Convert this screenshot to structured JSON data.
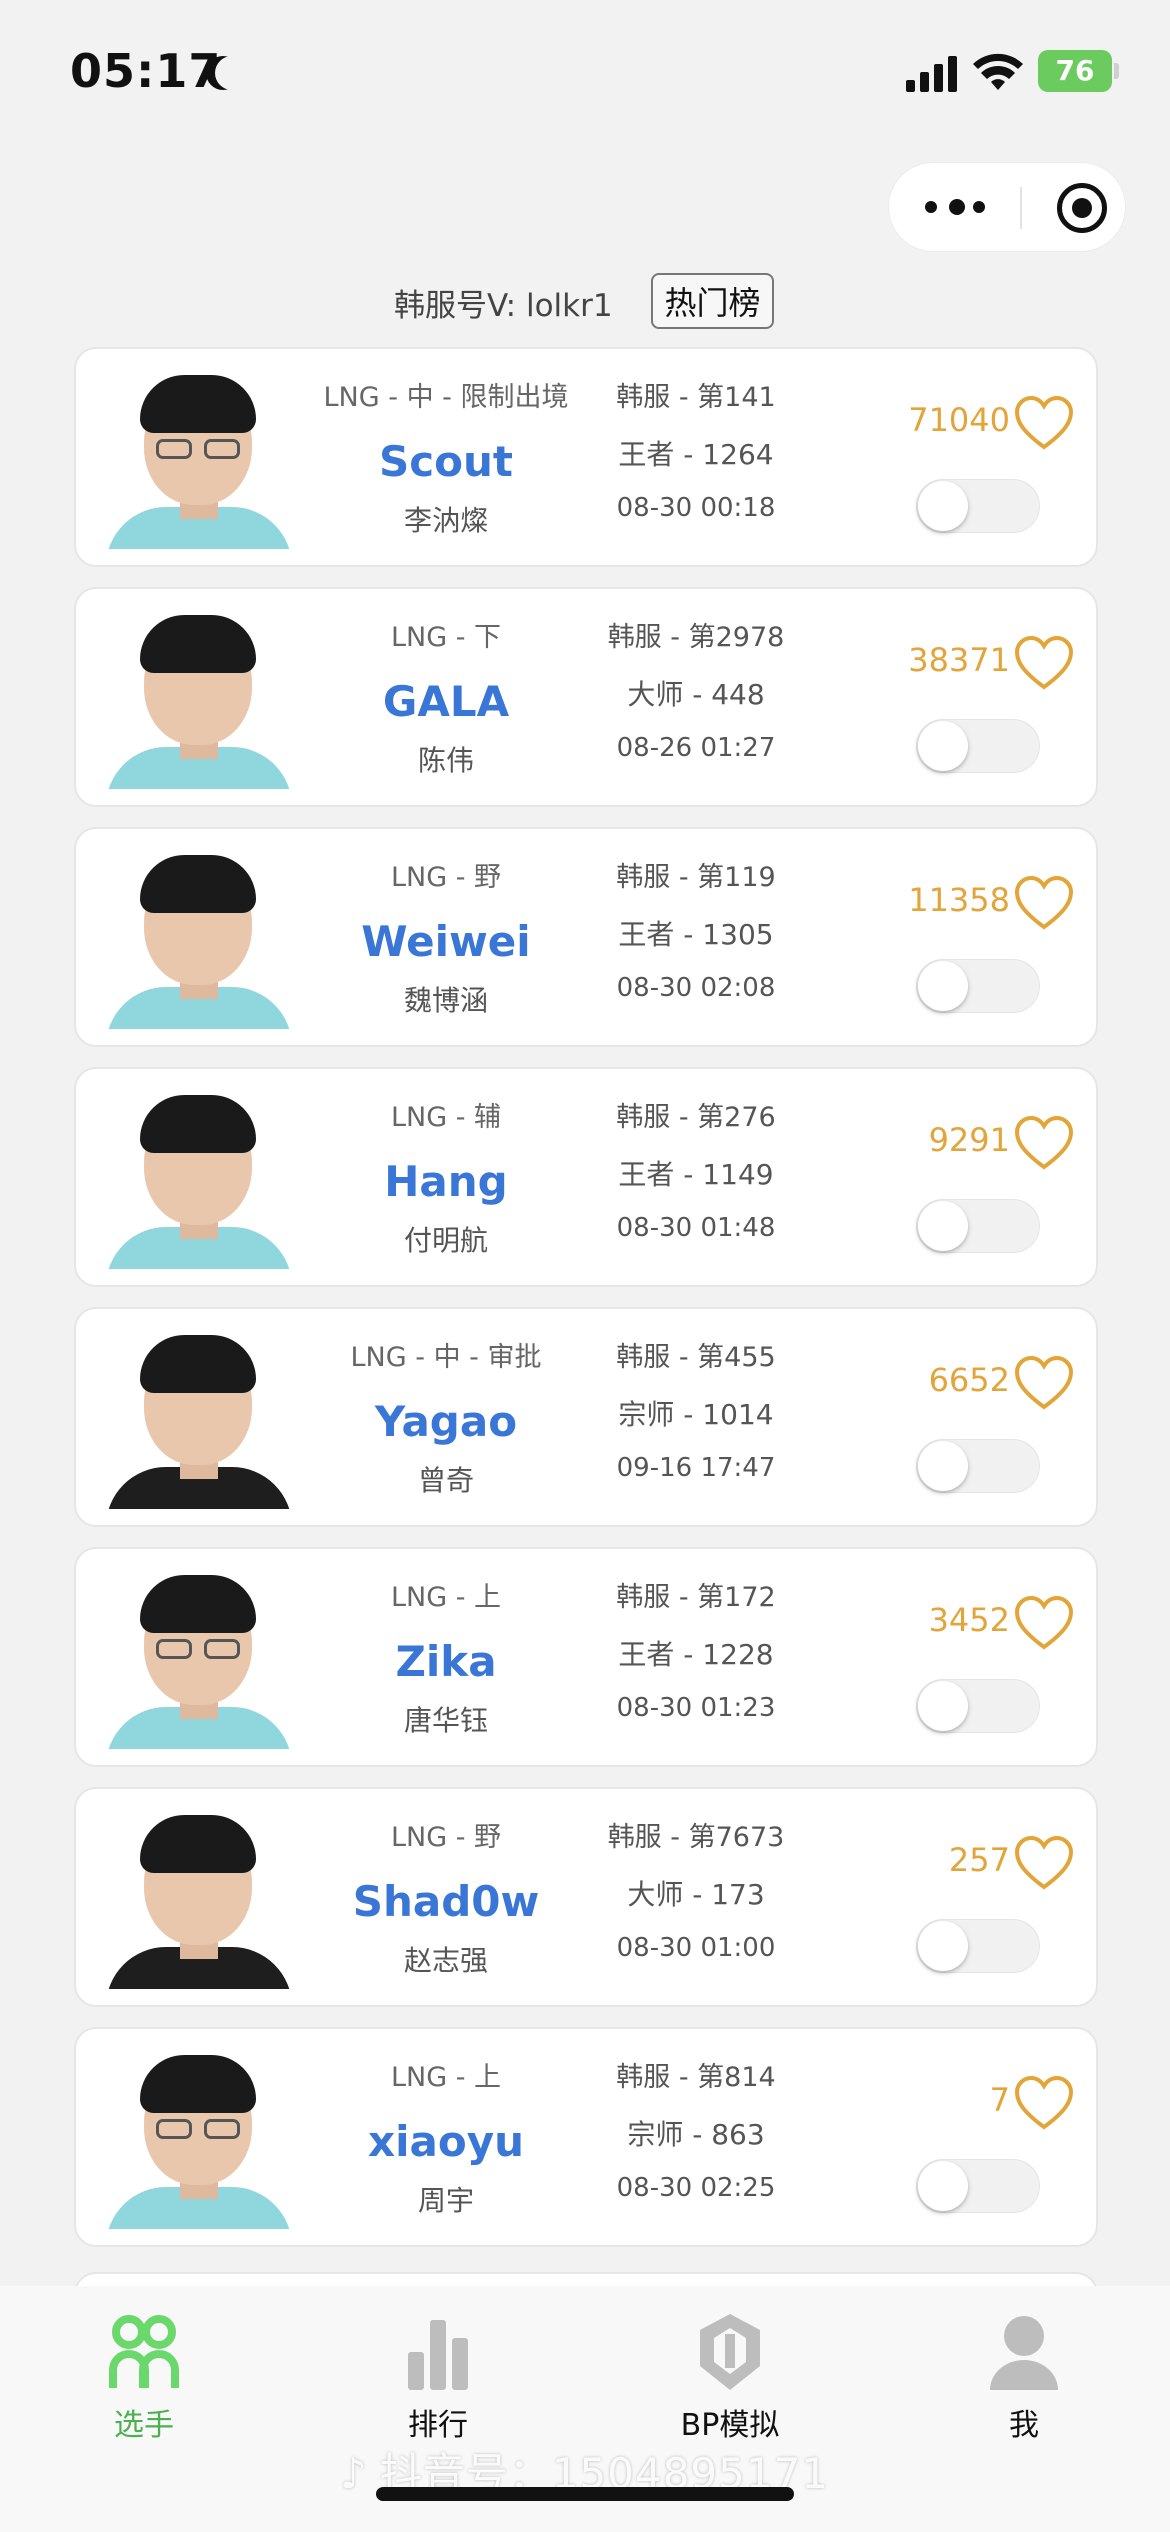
{
  "status_bar": {
    "time": "05:17",
    "battery": "76"
  },
  "header": {
    "account_label": "韩服号V: lolkr1",
    "hot_button": "热门榜"
  },
  "players": [
    {
      "team": "LNG - 中 - 限制出境",
      "name": "Scout",
      "real_name": "李汭燦",
      "server": "韩服 - 第141",
      "tier": "王者 - 1264",
      "date": "08-30 00:18",
      "likes": "71040",
      "glasses": true,
      "jersey": "light"
    },
    {
      "team": "LNG - 下",
      "name": "GALA",
      "real_name": "陈伟",
      "server": "韩服 - 第2978",
      "tier": "大师 - 448",
      "date": "08-26 01:27",
      "likes": "38371",
      "glasses": false,
      "jersey": "light"
    },
    {
      "team": "LNG - 野",
      "name": "Weiwei",
      "real_name": "魏博涵",
      "server": "韩服 - 第119",
      "tier": "王者 - 1305",
      "date": "08-30 02:08",
      "likes": "11358",
      "glasses": false,
      "jersey": "light"
    },
    {
      "team": "LNG - 辅",
      "name": "Hang",
      "real_name": "付明航",
      "server": "韩服 - 第276",
      "tier": "王者 - 1149",
      "date": "08-30 01:48",
      "likes": "9291",
      "glasses": false,
      "jersey": "light"
    },
    {
      "team": "LNG - 中 - 审批",
      "name": "Yagao",
      "real_name": "曾奇",
      "server": "韩服 - 第455",
      "tier": "宗师 - 1014",
      "date": "09-16 17:47",
      "likes": "6652",
      "glasses": false,
      "jersey": "dark"
    },
    {
      "team": "LNG - 上",
      "name": "Zika",
      "real_name": "唐华钰",
      "server": "韩服 - 第172",
      "tier": "王者 - 1228",
      "date": "08-30 01:23",
      "likes": "3452",
      "glasses": true,
      "jersey": "light"
    },
    {
      "team": "LNG - 野",
      "name": "Shad0w",
      "real_name": "赵志强",
      "server": "韩服 - 第7673",
      "tier": "大师 - 173",
      "date": "08-30 01:00",
      "likes": "257",
      "glasses": false,
      "jersey": "dark"
    },
    {
      "team": "LNG - 上",
      "name": "xiaoyu",
      "real_name": "周宇",
      "server": "韩服 - 第814",
      "tier": "宗师 - 863",
      "date": "08-30 02:25",
      "likes": "7",
      "glasses": true,
      "jersey": "light"
    }
  ],
  "tabbar": [
    {
      "label": "选手",
      "icon": "players-icon",
      "active": true
    },
    {
      "label": "排行",
      "icon": "ranking-icon",
      "active": false
    },
    {
      "label": "BP模拟",
      "icon": "bp-icon",
      "active": false
    },
    {
      "label": "我",
      "icon": "profile-icon",
      "active": false
    }
  ],
  "watermark": "抖音号：1504895171",
  "colors": {
    "accent": "#3a76d6",
    "likes": "#e3a43a",
    "active_tab": "#4caf50"
  }
}
